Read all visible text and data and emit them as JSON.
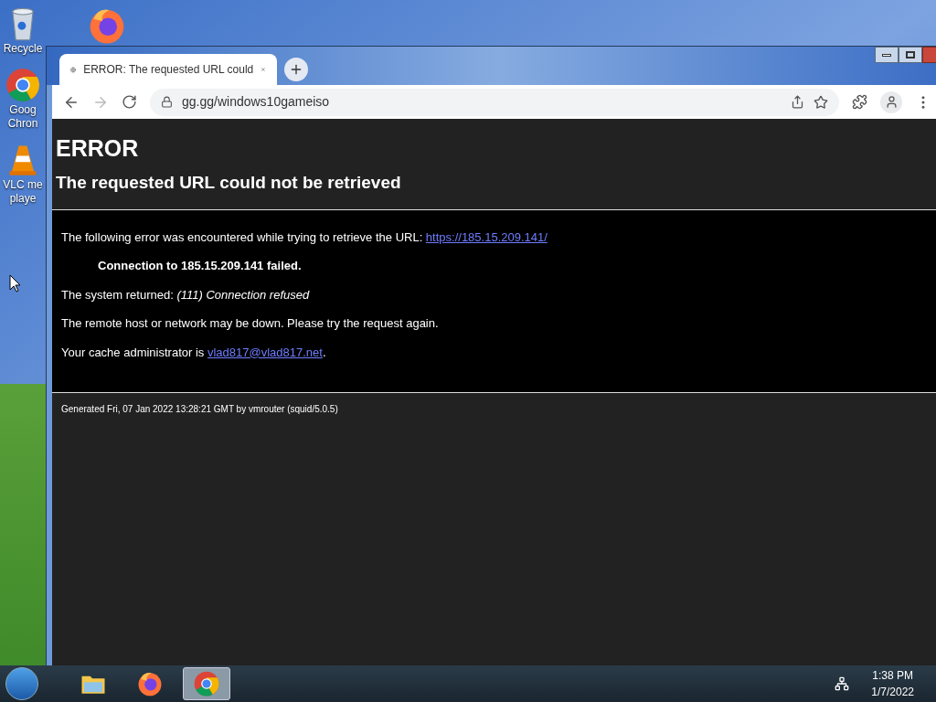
{
  "desktop_icons": [
    {
      "kind": "recycle",
      "label": [
        "Recycle"
      ]
    },
    {
      "kind": "firefox"
    },
    {
      "kind": "chrome",
      "label": [
        "Goog",
        "Chron"
      ]
    },
    {
      "kind": "vlc",
      "label": [
        "VLC me",
        "playe"
      ]
    }
  ],
  "browser": {
    "tab": {
      "title": "ERROR: The requested URL could",
      "selected": true
    },
    "address": "gg.gg/windows10gameiso"
  },
  "page": {
    "heading": "ERROR",
    "subheading": "The requested URL could not be retrieved",
    "intro": "The following error was encountered while trying to retrieve the URL: ",
    "url_link": "https://185.15.209.141/",
    "failure": "Connection to 185.15.209.141 failed.",
    "system_returned": "The system returned: *(111) Connection refused*",
    "remote": "The remote host or network may be down. Please try the request again.",
    "admin": "Your cache administrator is ",
    "admin_link": "vlad817@vlad817.net",
    "admin_end": ".",
    "footer": "Generated Fri, 07 Jan 2022 13:28:21 GMT by vmrouter (squid/5.0.5)"
  },
  "taskbar": {
    "apps": [
      {
        "kind": "explorer",
        "selected": false
      },
      {
        "kind": "firefox",
        "selected": false
      },
      {
        "kind": "chrome",
        "selected": true
      }
    ],
    "time": "1:38 PM",
    "date": "1/7/2022"
  }
}
